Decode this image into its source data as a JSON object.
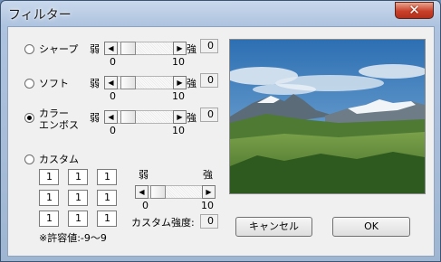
{
  "title": "フィルター",
  "close_icon": "close-icon",
  "labels": {
    "weak": "弱",
    "strong": "強",
    "min": "0",
    "max": "10",
    "arrow_left": "◀",
    "arrow_right": "▶",
    "close": "✕"
  },
  "filters": [
    {
      "label": "シャープ",
      "selected": false,
      "value": "0",
      "level": 0.1
    },
    {
      "label": "ソフト",
      "selected": false,
      "value": "0",
      "level": 0.1
    },
    {
      "label_line1": "カラー",
      "label_line2": "エンボス",
      "selected": true,
      "value": "0",
      "level": 0.1
    }
  ],
  "custom": {
    "label": "カスタム",
    "selected": false,
    "matrix": [
      [
        "1",
        "1",
        "1"
      ],
      [
        "1",
        "1",
        "1"
      ],
      [
        "1",
        "1",
        "1"
      ]
    ],
    "note": "※許容値:-9～9",
    "strength_label": "カスタム強度:",
    "strength_value": "0",
    "level": 0.1
  },
  "buttons": {
    "cancel": "キャンセル",
    "ok": "OK"
  },
  "colors": {
    "titlebar": "#aec3df",
    "close": "#c9402a",
    "dialog_bg": "#f0f0f0"
  }
}
